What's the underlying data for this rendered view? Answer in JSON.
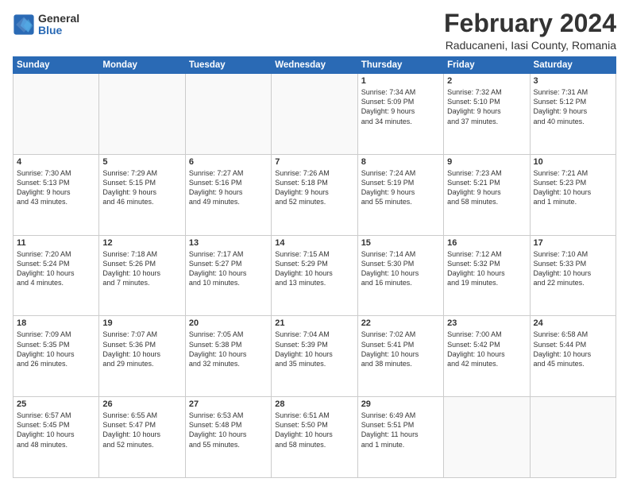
{
  "logo": {
    "general": "General",
    "blue": "Blue"
  },
  "title": "February 2024",
  "subtitle": "Raducaneni, Iasi County, Romania",
  "header_days": [
    "Sunday",
    "Monday",
    "Tuesday",
    "Wednesday",
    "Thursday",
    "Friday",
    "Saturday"
  ],
  "weeks": [
    [
      {
        "day": "",
        "info": ""
      },
      {
        "day": "",
        "info": ""
      },
      {
        "day": "",
        "info": ""
      },
      {
        "day": "",
        "info": ""
      },
      {
        "day": "1",
        "info": "Sunrise: 7:34 AM\nSunset: 5:09 PM\nDaylight: 9 hours\nand 34 minutes."
      },
      {
        "day": "2",
        "info": "Sunrise: 7:32 AM\nSunset: 5:10 PM\nDaylight: 9 hours\nand 37 minutes."
      },
      {
        "day": "3",
        "info": "Sunrise: 7:31 AM\nSunset: 5:12 PM\nDaylight: 9 hours\nand 40 minutes."
      }
    ],
    [
      {
        "day": "4",
        "info": "Sunrise: 7:30 AM\nSunset: 5:13 PM\nDaylight: 9 hours\nand 43 minutes."
      },
      {
        "day": "5",
        "info": "Sunrise: 7:29 AM\nSunset: 5:15 PM\nDaylight: 9 hours\nand 46 minutes."
      },
      {
        "day": "6",
        "info": "Sunrise: 7:27 AM\nSunset: 5:16 PM\nDaylight: 9 hours\nand 49 minutes."
      },
      {
        "day": "7",
        "info": "Sunrise: 7:26 AM\nSunset: 5:18 PM\nDaylight: 9 hours\nand 52 minutes."
      },
      {
        "day": "8",
        "info": "Sunrise: 7:24 AM\nSunset: 5:19 PM\nDaylight: 9 hours\nand 55 minutes."
      },
      {
        "day": "9",
        "info": "Sunrise: 7:23 AM\nSunset: 5:21 PM\nDaylight: 9 hours\nand 58 minutes."
      },
      {
        "day": "10",
        "info": "Sunrise: 7:21 AM\nSunset: 5:23 PM\nDaylight: 10 hours\nand 1 minute."
      }
    ],
    [
      {
        "day": "11",
        "info": "Sunrise: 7:20 AM\nSunset: 5:24 PM\nDaylight: 10 hours\nand 4 minutes."
      },
      {
        "day": "12",
        "info": "Sunrise: 7:18 AM\nSunset: 5:26 PM\nDaylight: 10 hours\nand 7 minutes."
      },
      {
        "day": "13",
        "info": "Sunrise: 7:17 AM\nSunset: 5:27 PM\nDaylight: 10 hours\nand 10 minutes."
      },
      {
        "day": "14",
        "info": "Sunrise: 7:15 AM\nSunset: 5:29 PM\nDaylight: 10 hours\nand 13 minutes."
      },
      {
        "day": "15",
        "info": "Sunrise: 7:14 AM\nSunset: 5:30 PM\nDaylight: 10 hours\nand 16 minutes."
      },
      {
        "day": "16",
        "info": "Sunrise: 7:12 AM\nSunset: 5:32 PM\nDaylight: 10 hours\nand 19 minutes."
      },
      {
        "day": "17",
        "info": "Sunrise: 7:10 AM\nSunset: 5:33 PM\nDaylight: 10 hours\nand 22 minutes."
      }
    ],
    [
      {
        "day": "18",
        "info": "Sunrise: 7:09 AM\nSunset: 5:35 PM\nDaylight: 10 hours\nand 26 minutes."
      },
      {
        "day": "19",
        "info": "Sunrise: 7:07 AM\nSunset: 5:36 PM\nDaylight: 10 hours\nand 29 minutes."
      },
      {
        "day": "20",
        "info": "Sunrise: 7:05 AM\nSunset: 5:38 PM\nDaylight: 10 hours\nand 32 minutes."
      },
      {
        "day": "21",
        "info": "Sunrise: 7:04 AM\nSunset: 5:39 PM\nDaylight: 10 hours\nand 35 minutes."
      },
      {
        "day": "22",
        "info": "Sunrise: 7:02 AM\nSunset: 5:41 PM\nDaylight: 10 hours\nand 38 minutes."
      },
      {
        "day": "23",
        "info": "Sunrise: 7:00 AM\nSunset: 5:42 PM\nDaylight: 10 hours\nand 42 minutes."
      },
      {
        "day": "24",
        "info": "Sunrise: 6:58 AM\nSunset: 5:44 PM\nDaylight: 10 hours\nand 45 minutes."
      }
    ],
    [
      {
        "day": "25",
        "info": "Sunrise: 6:57 AM\nSunset: 5:45 PM\nDaylight: 10 hours\nand 48 minutes."
      },
      {
        "day": "26",
        "info": "Sunrise: 6:55 AM\nSunset: 5:47 PM\nDaylight: 10 hours\nand 52 minutes."
      },
      {
        "day": "27",
        "info": "Sunrise: 6:53 AM\nSunset: 5:48 PM\nDaylight: 10 hours\nand 55 minutes."
      },
      {
        "day": "28",
        "info": "Sunrise: 6:51 AM\nSunset: 5:50 PM\nDaylight: 10 hours\nand 58 minutes."
      },
      {
        "day": "29",
        "info": "Sunrise: 6:49 AM\nSunset: 5:51 PM\nDaylight: 11 hours\nand 1 minute."
      },
      {
        "day": "",
        "info": ""
      },
      {
        "day": "",
        "info": ""
      }
    ]
  ]
}
